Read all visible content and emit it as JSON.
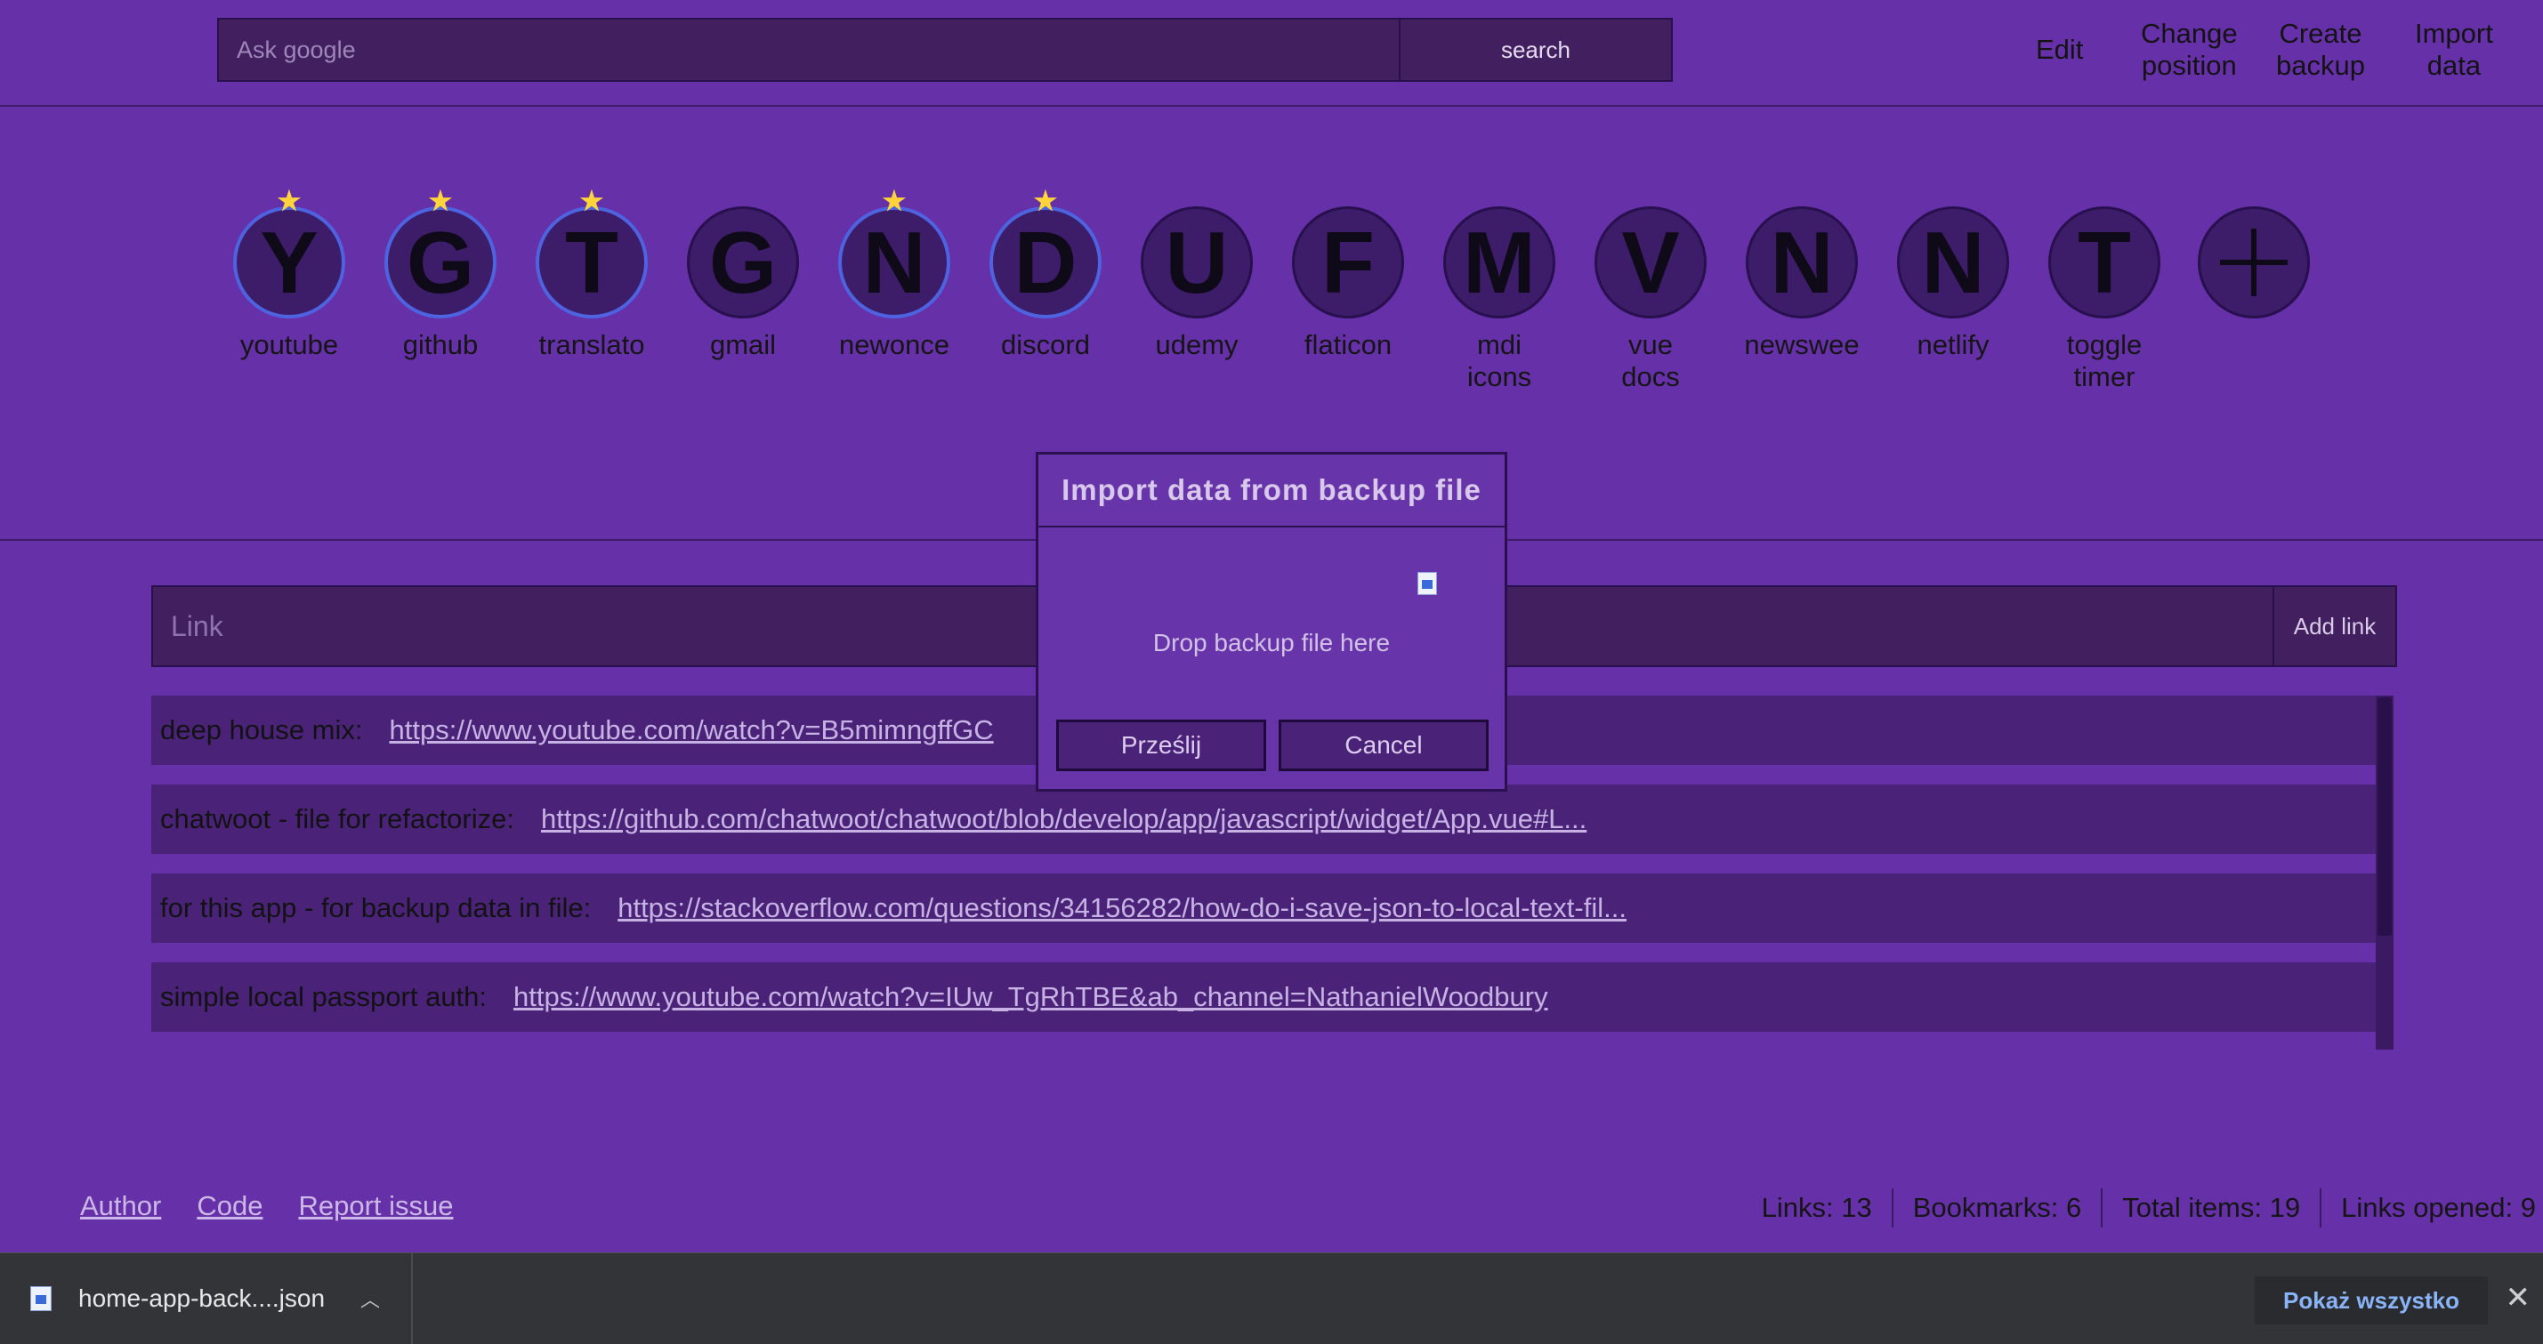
{
  "search": {
    "placeholder": "Ask google",
    "button": "search"
  },
  "nav": [
    "Edit",
    "Change\nposition",
    "Create\nbackup",
    "Import\ndata"
  ],
  "bookmarks": [
    {
      "letter": "Y",
      "label": "youtube",
      "starred": true
    },
    {
      "letter": "G",
      "label": "github",
      "starred": true
    },
    {
      "letter": "T",
      "label": "translato",
      "starred": true
    },
    {
      "letter": "G",
      "label": "gmail",
      "starred": false
    },
    {
      "letter": "N",
      "label": "newonce",
      "starred": true
    },
    {
      "letter": "D",
      "label": "discord",
      "starred": true
    },
    {
      "letter": "U",
      "label": "udemy",
      "starred": false
    },
    {
      "letter": "F",
      "label": "flaticon",
      "starred": false
    },
    {
      "letter": "M",
      "label": "mdi\nicons",
      "starred": false
    },
    {
      "letter": "V",
      "label": "vue\ndocs",
      "starred": false
    },
    {
      "letter": "N",
      "label": "newswee",
      "starred": false
    },
    {
      "letter": "N",
      "label": "netlify",
      "starred": false
    },
    {
      "letter": "T",
      "label": "toggle\ntimer",
      "starred": false
    }
  ],
  "link_input": {
    "placeholder": "Link",
    "button": "Add link"
  },
  "links": [
    {
      "desc": "deep house mix:",
      "url": "https://www.youtube.com/watch?v=B5mimngffGC"
    },
    {
      "desc": "chatwoot - file for refactorize:",
      "url": "https://github.com/chatwoot/chatwoot/blob/develop/app/javascript/widget/App.vue#L..."
    },
    {
      "desc": "for this app - for backup data in file:",
      "url": "https://stackoverflow.com/questions/34156282/how-do-i-save-json-to-local-text-fil..."
    },
    {
      "desc": "simple local passport auth:",
      "url": "https://www.youtube.com/watch?v=IUw_TgRhTBE&ab_channel=NathanielWoodbury"
    }
  ],
  "modal": {
    "title": "Import data from backup file",
    "drop_text": "Drop backup file here",
    "submit": "Prześlij",
    "cancel": "Cancel"
  },
  "footer": {
    "links": [
      "Author",
      "Code",
      "Report issue"
    ],
    "stats": [
      "Links: 13",
      "Bookmarks: 6",
      "Total items: 19",
      "Links opened: 9"
    ]
  },
  "downloads": {
    "file_name": "home-app-back....json",
    "show_all": "Pokaż wszystko"
  },
  "colors": {
    "background": "#6630a9",
    "panel": "#42205f",
    "star": "#ffd43a",
    "starred_ring": "#4d63e0"
  },
  "icons": {
    "star": "star-icon",
    "plus": "plus-icon",
    "file": "file-icon",
    "chevron": "chevron-up-icon",
    "close": "close-icon"
  }
}
